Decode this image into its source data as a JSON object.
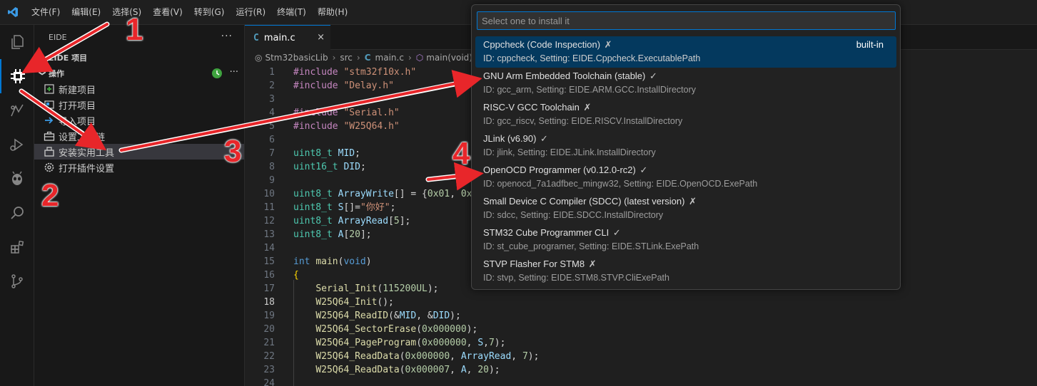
{
  "menu": [
    "文件(F)",
    "编辑(E)",
    "选择(S)",
    "查看(V)",
    "转到(G)",
    "运行(R)",
    "终端(T)",
    "帮助(H)"
  ],
  "sidebar": {
    "title": "EIDE",
    "more": "···",
    "section_project": "EIDE 项目",
    "section_ops": "操作",
    "items": [
      {
        "label": "新建项目",
        "icon": "new-project-icon"
      },
      {
        "label": "打开项目",
        "icon": "open-project-icon"
      },
      {
        "label": "导入项目",
        "icon": "import-project-icon"
      },
      {
        "label": "设置工具链",
        "icon": "toolbox-icon"
      },
      {
        "label": "安装实用工具",
        "icon": "install-tools-icon"
      },
      {
        "label": "打开插件设置",
        "icon": "gear-icon"
      }
    ]
  },
  "editor": {
    "tab_label": "main.c",
    "tab_close": "×",
    "breadcrumb": [
      "Stm32basicLib",
      "src",
      "main.c",
      "main(void)"
    ]
  },
  "quickpick": {
    "placeholder": "Select one to install it",
    "items": [
      {
        "label": "Cppcheck (Code Inspection)",
        "mark": "✗",
        "desc": "ID: cppcheck, Setting: EIDE.Cppcheck.ExecutablePath",
        "tag": "built-in"
      },
      {
        "label": "GNU Arm Embedded Toolchain (stable)",
        "mark": "✓",
        "desc": "ID: gcc_arm, Setting: EIDE.ARM.GCC.InstallDirectory",
        "tag": ""
      },
      {
        "label": "RISC-V GCC Toolchain",
        "mark": "✗",
        "desc": "ID: gcc_riscv, Setting: EIDE.RISCV.InstallDirectory",
        "tag": ""
      },
      {
        "label": "JLink (v6.90)",
        "mark": "✓",
        "desc": "ID: jlink, Setting: EIDE.JLink.InstallDirectory",
        "tag": ""
      },
      {
        "label": "OpenOCD Programmer (v0.12.0-rc2)",
        "mark": "✓",
        "desc": "ID: openocd_7a1adfbec_mingw32, Setting: EIDE.OpenOCD.ExePath",
        "tag": ""
      },
      {
        "label": "Small Device C Compiler (SDCC) (latest version)",
        "mark": "✗",
        "desc": "ID: sdcc, Setting: EIDE.SDCC.InstallDirectory",
        "tag": ""
      },
      {
        "label": "STM32 Cube Programmer CLI",
        "mark": "✓",
        "desc": "ID: st_cube_programer, Setting: EIDE.STLink.ExePath",
        "tag": ""
      },
      {
        "label": "STVP Flasher For STM8",
        "mark": "✗",
        "desc": "ID: stvp, Setting: EIDE.STM8.STVP.CliExePath",
        "tag": ""
      }
    ]
  },
  "code_lines": [
    {
      "n": "1",
      "t": [
        [
          "pp",
          "#include "
        ],
        [
          "str",
          "\"stm32f10x.h\""
        ]
      ]
    },
    {
      "n": "2",
      "t": [
        [
          "pp",
          "#include "
        ],
        [
          "str",
          "\"Delay.h\""
        ]
      ]
    },
    {
      "n": "3",
      "t": []
    },
    {
      "n": "4",
      "t": [
        [
          "pp",
          "#include "
        ],
        [
          "str",
          "\"Serial.h\""
        ]
      ]
    },
    {
      "n": "5",
      "t": [
        [
          "pp",
          "#include "
        ],
        [
          "str",
          "\"W25Q64.h\""
        ]
      ]
    },
    {
      "n": "6",
      "t": []
    },
    {
      "n": "7",
      "t": [
        [
          "ty",
          "uint8_t "
        ],
        [
          "var",
          "MID"
        ],
        [
          "",
          "; "
        ]
      ]
    },
    {
      "n": "8",
      "t": [
        [
          "ty",
          "uint16_t "
        ],
        [
          "var",
          "DID"
        ],
        [
          "",
          ";"
        ]
      ]
    },
    {
      "n": "9",
      "t": []
    },
    {
      "n": "10",
      "t": [
        [
          "ty",
          "uint8_t "
        ],
        [
          "var",
          "ArrayWrite"
        ],
        [
          "",
          "[] = {"
        ],
        [
          "num",
          "0x01"
        ],
        [
          "",
          ", "
        ],
        [
          "num",
          "0x0"
        ]
      ]
    },
    {
      "n": "11",
      "t": [
        [
          "ty",
          "uint8_t "
        ],
        [
          "var",
          "S"
        ],
        [
          "",
          "[]="
        ],
        [
          "str",
          "\"你好\""
        ],
        [
          "",
          ";"
        ]
      ]
    },
    {
      "n": "12",
      "t": [
        [
          "ty",
          "uint8_t "
        ],
        [
          "var",
          "ArrayRead"
        ],
        [
          "",
          "["
        ],
        [
          "num",
          "5"
        ],
        [
          "",
          "];"
        ]
      ]
    },
    {
      "n": "13",
      "t": [
        [
          "ty",
          "uint8_t "
        ],
        [
          "var",
          "A"
        ],
        [
          "",
          "["
        ],
        [
          "num",
          "20"
        ],
        [
          "",
          "];"
        ]
      ]
    },
    {
      "n": "14",
      "t": []
    },
    {
      "n": "15",
      "t": [
        [
          "kw",
          "int "
        ],
        [
          "fn",
          "main"
        ],
        [
          "",
          "("
        ],
        [
          "kw",
          "void"
        ],
        [
          "",
          ")"
        ]
      ]
    },
    {
      "n": "16",
      "t": [
        [
          "br",
          "{"
        ]
      ]
    },
    {
      "n": "17",
      "t": [
        [
          "",
          "    "
        ],
        [
          "fn",
          "Serial_Init"
        ],
        [
          "",
          "("
        ],
        [
          "num",
          "115200UL"
        ],
        [
          "",
          ");"
        ]
      ]
    },
    {
      "n": "18",
      "t": [
        [
          "",
          "    "
        ],
        [
          "fn",
          "W25Q64_Init"
        ],
        [
          "",
          "();"
        ]
      ]
    },
    {
      "n": "19",
      "t": [
        [
          "",
          "    "
        ],
        [
          "fn",
          "W25Q64_ReadID"
        ],
        [
          "",
          "(&"
        ],
        [
          "var",
          "MID"
        ],
        [
          "",
          ", &"
        ],
        [
          "var",
          "DID"
        ],
        [
          "",
          ");"
        ]
      ]
    },
    {
      "n": "20",
      "t": [
        [
          "",
          "    "
        ],
        [
          "fn",
          "W25Q64_SectorErase"
        ],
        [
          "",
          "("
        ],
        [
          "num",
          "0x000000"
        ],
        [
          "",
          ");"
        ]
      ]
    },
    {
      "n": "21",
      "t": [
        [
          "",
          "    "
        ],
        [
          "fn",
          "W25Q64_PageProgram"
        ],
        [
          "",
          "("
        ],
        [
          "num",
          "0x000000"
        ],
        [
          "",
          ", "
        ],
        [
          "var",
          "S"
        ],
        [
          "",
          ","
        ],
        [
          "num",
          "7"
        ],
        [
          "",
          ");"
        ]
      ]
    },
    {
      "n": "22",
      "t": [
        [
          "",
          "    "
        ],
        [
          "fn",
          "W25Q64_ReadData"
        ],
        [
          "",
          "("
        ],
        [
          "num",
          "0x000000"
        ],
        [
          "",
          ", "
        ],
        [
          "var",
          "ArrayRead"
        ],
        [
          "",
          ", "
        ],
        [
          "num",
          "7"
        ],
        [
          "",
          ");"
        ]
      ]
    },
    {
      "n": "23",
      "t": [
        [
          "",
          "    "
        ],
        [
          "fn",
          "W25Q64_ReadData"
        ],
        [
          "",
          "("
        ],
        [
          "num",
          "0x000007"
        ],
        [
          "",
          ", "
        ],
        [
          "var",
          "A"
        ],
        [
          "",
          ", "
        ],
        [
          "num",
          "20"
        ],
        [
          "",
          ");"
        ]
      ]
    },
    {
      "n": "24",
      "t": []
    }
  ],
  "current_line": "18",
  "annotations": [
    "1",
    "2",
    "3",
    "4"
  ],
  "colors": {
    "accent": "#0078d4",
    "annotation": "#e8262a",
    "selection": "#04395e"
  }
}
